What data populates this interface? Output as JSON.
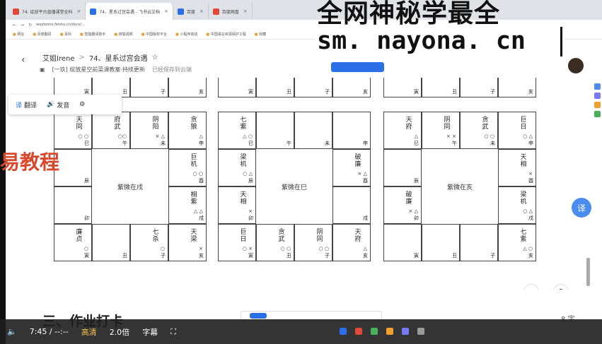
{
  "browser": {
    "tabs": [
      {
        "label": "74. 绽放平台直播课堂全科",
        "color": "#e04a3a"
      },
      {
        "label": "74、星系过宫会遇 - 飞书云文档",
        "color": "#2a6ee8"
      },
      {
        "label": "百度",
        "color": "#2a6ee8"
      },
      {
        "label": "百度网盘",
        "color": "#e04a3a"
      }
    ],
    "url": "waytoone.feishu.cn/docx/...",
    "bookmarks": [
      "网址",
      "百度翻译",
      "百科",
      "智能翻译助手",
      "搜狐视频",
      "中国版权平台",
      "小程序商店",
      "中国语言资源保护工程",
      "收藏"
    ]
  },
  "watermark": {
    "top_text": "全网神秘学最全",
    "url": "sm. nayona. cn",
    "red_text": "易教程"
  },
  "doc": {
    "breadcrumb_user": "艾姐Irene",
    "breadcrumb_sep": ">",
    "breadcrumb_title": "74、星系过宫会遇",
    "star_icon": "☆",
    "subtitle": "[一玖] 绽放星空前菜课教案·持续更新",
    "saved": "已经保存到云端"
  },
  "toolbar": {
    "translate": "翻译",
    "speak": "发音",
    "translate_icon": "译",
    "speak_icon": "🔊",
    "settings_icon": "⚙"
  },
  "charts": [
    {
      "center": "紫微在戌",
      "top_branches": [
        "寅",
        "丑",
        "子",
        "亥"
      ],
      "cells": {
        "si": {
          "stars": "天同",
          "marks": "○ ○",
          "branch": "巳"
        },
        "wu": {
          "stars": "府武",
          "marks": "○○",
          "branch": "午"
        },
        "wei": {
          "stars": "阴阳",
          "marks": "× △",
          "branch": "未"
        },
        "shen": {
          "stars": "贪狼",
          "marks": "△",
          "branch": "申"
        },
        "chen": {
          "stars": "",
          "marks": "",
          "branch": "辰"
        },
        "you": {
          "stars": "巨机",
          "marks": "○ ○",
          "branch": "酉"
        },
        "mao": {
          "stars": "",
          "marks": "",
          "branch": "卯"
        },
        "xu": {
          "stars": "相紫",
          "marks": "△ △",
          "branch": "戌"
        },
        "yin": {
          "stars": "廉贞",
          "marks": "○",
          "branch": "寅"
        },
        "chou": {
          "stars": "",
          "marks": "",
          "branch": "丑"
        },
        "zi": {
          "stars": "七杀",
          "marks": "○",
          "branch": "子"
        },
        "hai": {
          "stars": "天梁",
          "marks": "×",
          "branch": "亥"
        }
      }
    },
    {
      "center": "紫微在巳",
      "top_branches": [
        "寅",
        "丑",
        "子",
        "亥"
      ],
      "cells": {
        "si": {
          "stars": "七紫",
          "marks": "△ ○",
          "branch": "巳"
        },
        "wu": {
          "stars": "",
          "marks": "",
          "branch": "午"
        },
        "wei": {
          "stars": "",
          "marks": "",
          "branch": "未"
        },
        "shen": {
          "stars": "",
          "marks": "",
          "branch": "申"
        },
        "chen": {
          "stars": "梁机",
          "marks": "○ △",
          "branch": "辰"
        },
        "you": {
          "stars": "破廉",
          "marks": "× △",
          "branch": "酉"
        },
        "mao": {
          "stars": "天相",
          "marks": "×",
          "branch": "卯"
        },
        "xu": {
          "stars": "",
          "marks": "",
          "branch": "戌"
        },
        "yin": {
          "stars": "巨日",
          "marks": "○ ×",
          "branch": "寅"
        },
        "chou": {
          "stars": "贪武",
          "marks": "○ ○",
          "branch": "丑"
        },
        "zi": {
          "stars": "阴同",
          "marks": "○ ○",
          "branch": "子"
        },
        "hai": {
          "stars": "天府",
          "marks": "△",
          "branch": "亥"
        }
      }
    },
    {
      "center": "紫微在亥",
      "top_branches": [
        "寅",
        "丑",
        "子",
        "亥"
      ],
      "cells": {
        "si": {
          "stars": "天府",
          "marks": "△",
          "branch": "巳"
        },
        "wu": {
          "stars": "阴同",
          "marks": "× ×",
          "branch": "午"
        },
        "wei": {
          "stars": "贪武",
          "marks": "○ ○",
          "branch": "未"
        },
        "shen": {
          "stars": "巨日",
          "marks": "○ △",
          "branch": "申"
        },
        "chen": {
          "stars": "",
          "marks": "",
          "branch": "辰"
        },
        "you": {
          "stars": "天相",
          "marks": "×",
          "branch": "酉"
        },
        "mao": {
          "stars": "破廉",
          "marks": "× △",
          "branch": "卯"
        },
        "xu": {
          "stars": "梁机",
          "marks": "○ △",
          "branch": "戌"
        },
        "yin": {
          "stars": "",
          "marks": "",
          "branch": "寅"
        },
        "chou": {
          "stars": "",
          "marks": "",
          "branch": "丑"
        },
        "zi": {
          "stars": "",
          "marks": "",
          "branch": "子"
        },
        "hai": {
          "stars": "七紫",
          "marks": "△ ○",
          "branch": "亥"
        }
      }
    }
  ],
  "float": {
    "yi": "译"
  },
  "bottom": {
    "heading": "三、作业打卡",
    "char_count": "8 字"
  },
  "player": {
    "time": "7:45 / --:--",
    "quality": "高清",
    "speed": "2.0倍",
    "subtitle": "字幕",
    "fullscreen": "⛶",
    "volume": "🔈"
  }
}
